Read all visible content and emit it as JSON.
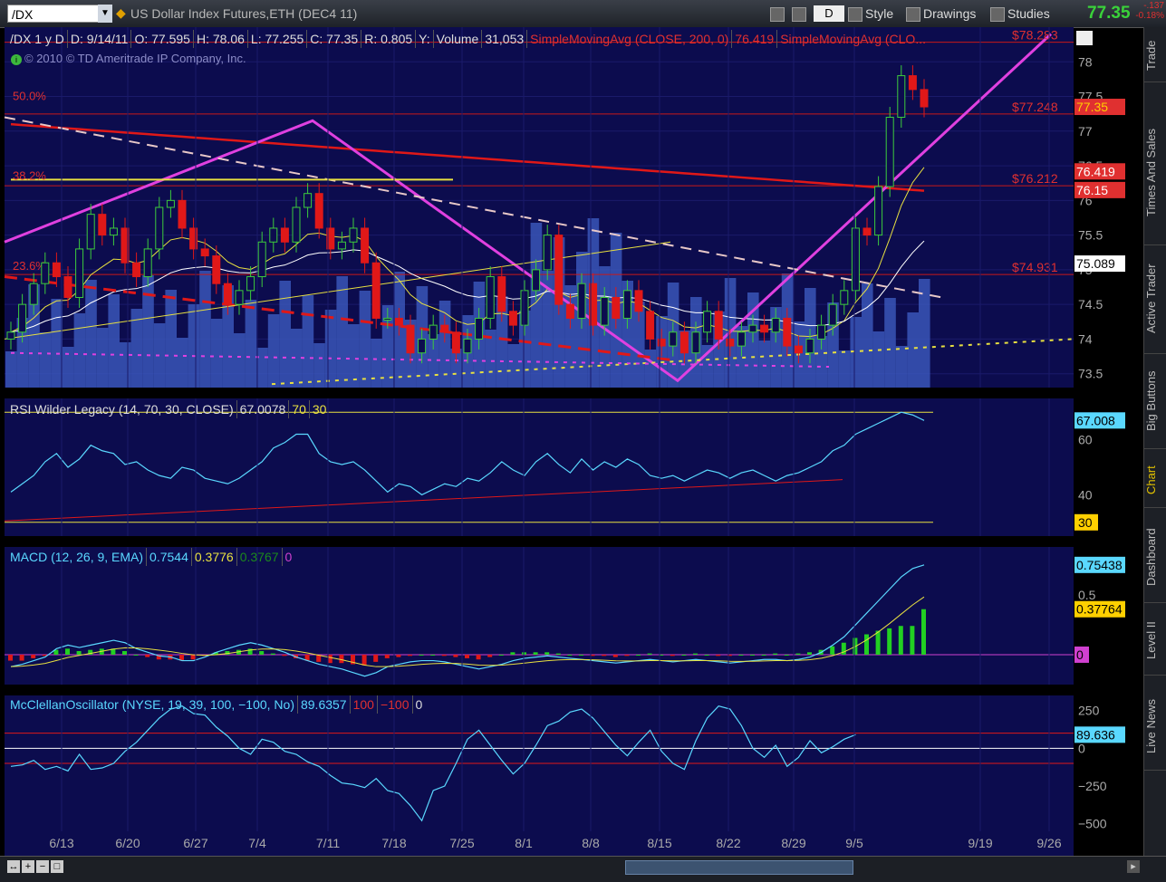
{
  "toolbar": {
    "symbol": "/DX",
    "description": "US Dollar Index Futures,ETH (DEC4 11)",
    "aggregation": "D",
    "style_label": "Style",
    "drawings_label": "Drawings",
    "studies_label": "Studies",
    "last_price": "77.35",
    "net_change": "-.137",
    "pct_change": "-0.18%"
  },
  "side_tabs": [
    "Trade",
    "Times And Sales",
    "Active Trader",
    "Big Buttons",
    "Chart",
    "Dashboard",
    "Level II",
    "Live News"
  ],
  "price_header": {
    "symbol": "/DX 1 y D",
    "date": "D: 9/14/11",
    "open": "O: 77.595",
    "high": "H: 78.06",
    "low": "L: 77.255",
    "close": "C: 77.35",
    "range": "R: 0.805",
    "y": "Y:",
    "volume_label": "Volume",
    "volume": "31,053",
    "sma200": "SimpleMovingAvg (CLOSE, 200, 0)",
    "sma200_val": "76.419",
    "sma2": "SimpleMovingAvg (CLO..."
  },
  "copyright": "© 2010 © TD Ameritrade IP Company, Inc.",
  "fib_labels": {
    "f50": "50.0%",
    "f382": "38.2%",
    "f236": "23.6%",
    "p78": "$78.283",
    "p77": "$77.248",
    "p76": "$76.212",
    "p74": "$74.931"
  },
  "price_badges": {
    "last": "77.35",
    "sma200": "76.419",
    "fib": "76.15",
    "sma": "75.089"
  },
  "rsi": {
    "title": "RSI Wilder Legacy (14, 70, 30, CLOSE)",
    "value": "67.0078",
    "ob": "70",
    "os": "30",
    "badge_val": "67.008",
    "badge_os": "30"
  },
  "macd": {
    "title": "MACD (12, 26, 9, EMA)",
    "v1": "0.7544",
    "v2": "0.3776",
    "v3": "0.3767",
    "v4": "0",
    "badge1": "0.75438",
    "badge2": "0.37764",
    "badge3": "0"
  },
  "mcclellan": {
    "title": "McClellanOscillator (NYSE, 19, 39, 100, −100, No)",
    "value": "89.6357",
    "up": "100",
    "down": "−100",
    "zero": "0",
    "badge": "89.636"
  },
  "colors": {
    "background": "#0c0c4e",
    "up": "#3ccc3c",
    "down": "#e01818",
    "volume": "#3a56b8",
    "fib": "#c81818"
  },
  "chart_data": [
    {
      "type": "candlestick",
      "title": "/DX 1 y D",
      "y_ticks": [
        "73.5",
        "74",
        "74.5",
        "75",
        "75.5",
        "76",
        "76.5",
        "77",
        "77.5",
        "78"
      ],
      "ylim": [
        73.3,
        78.5
      ],
      "x_ticks": [
        "6/13",
        "6/20",
        "6/27",
        "7/4",
        "7/11",
        "7/18",
        "7/25",
        "8/1",
        "8/8",
        "8/15",
        "8/22",
        "8/29",
        "9/5",
        "9/19",
        "9/26"
      ],
      "closes": [
        74.1,
        74.5,
        74.8,
        75.1,
        74.9,
        74.6,
        75.3,
        75.8,
        75.5,
        75.6,
        75.1,
        74.9,
        75.3,
        75.9,
        76.0,
        75.6,
        75.3,
        75.2,
        74.8,
        74.5,
        74.7,
        74.9,
        75.4,
        75.6,
        75.4,
        75.9,
        76.1,
        75.6,
        75.3,
        75.4,
        75.6,
        75.1,
        74.3,
        74.3,
        74.2,
        73.8,
        74.0,
        74.2,
        74.1,
        73.8,
        74.0,
        74.3,
        74.9,
        74.4,
        74.2,
        74.7,
        75.0,
        75.5,
        74.5,
        74.3,
        74.8,
        74.2,
        74.6,
        74.3,
        74.7,
        74.4,
        74.0,
        73.9,
        74.1,
        73.8,
        74.1,
        74.4,
        74.0,
        73.9,
        74.1,
        74.2,
        74.1,
        74.3,
        73.9,
        73.8,
        74.0,
        74.2,
        74.5,
        74.7,
        75.6,
        75.5,
        76.2,
        77.2,
        77.8,
        77.6,
        77.35
      ],
      "volume_fraction_hint": "bars",
      "sma_200_last": 76.419,
      "fib_levels": [
        {
          "pct": "50.0%",
          "price": 77.248
        },
        {
          "pct": "38.2%",
          "price": 76.212
        },
        {
          "pct": "23.6%",
          "price": 74.931
        }
      ]
    },
    {
      "type": "line",
      "title": "RSI Wilder Legacy (14, 70, 30, CLOSE)",
      "y_ticks": [
        "40",
        "60"
      ],
      "ylim": [
        25,
        75
      ],
      "values": [
        41,
        44,
        47,
        52,
        55,
        50,
        53,
        58,
        56,
        55,
        51,
        52,
        49,
        47,
        46,
        50,
        49,
        46,
        45,
        44,
        46,
        49,
        52,
        57,
        59,
        62,
        62,
        55,
        52,
        51,
        52,
        49,
        45,
        41,
        44,
        43,
        40,
        42,
        44,
        43,
        46,
        45,
        48,
        52,
        49,
        47,
        52,
        55,
        51,
        48,
        53,
        49,
        52,
        50,
        53,
        51,
        47,
        46,
        47,
        45,
        47,
        49,
        48,
        46,
        48,
        49,
        47,
        45,
        47,
        48,
        50,
        52,
        56,
        58,
        62,
        64,
        66,
        68,
        70,
        69,
        67
      ]
    },
    {
      "type": "bar",
      "title": "MACD (12, 26, 9, EMA)",
      "y_ticks": [
        "0.5"
      ],
      "ylim": [
        -0.25,
        0.9
      ],
      "macd": [
        -0.1,
        -0.08,
        -0.05,
        -0.02,
        0.05,
        0.08,
        0.06,
        0.08,
        0.1,
        0.12,
        0.1,
        0.05,
        0.02,
        -0.01,
        -0.02,
        -0.05,
        -0.05,
        -0.02,
        0.02,
        0.05,
        0.08,
        0.1,
        0.08,
        0.05,
        0.02,
        -0.02,
        -0.05,
        -0.08,
        -0.1,
        -0.12,
        -0.15,
        -0.18,
        -0.15,
        -0.1,
        -0.08,
        -0.06,
        -0.05,
        -0.05,
        -0.06,
        -0.08,
        -0.1,
        -0.12,
        -0.1,
        -0.08,
        -0.05,
        -0.03,
        -0.02,
        -0.01,
        -0.02,
        -0.03,
        -0.04,
        -0.05,
        -0.06,
        -0.07,
        -0.06,
        -0.05,
        -0.04,
        -0.05,
        -0.06,
        -0.05,
        -0.04,
        -0.05,
        -0.06,
        -0.07,
        -0.06,
        -0.05,
        -0.04,
        -0.04,
        -0.05,
        -0.04,
        -0.02,
        0.02,
        0.08,
        0.15,
        0.25,
        0.35,
        0.45,
        0.55,
        0.65,
        0.72,
        0.75
      ],
      "hist": [
        -0.05,
        -0.05,
        -0.03,
        -0.01,
        0.04,
        0.05,
        0.03,
        0.04,
        0.05,
        0.05,
        0.03,
        0.0,
        -0.02,
        -0.04,
        -0.04,
        -0.05,
        -0.04,
        -0.01,
        0.02,
        0.03,
        0.04,
        0.05,
        0.03,
        0.01,
        -0.01,
        -0.03,
        -0.05,
        -0.06,
        -0.07,
        -0.07,
        -0.08,
        -0.09,
        -0.06,
        -0.03,
        -0.02,
        -0.01,
        0.0,
        0.0,
        -0.01,
        -0.02,
        -0.03,
        -0.04,
        -0.02,
        0.0,
        0.02,
        0.02,
        0.02,
        0.02,
        0.01,
        0.0,
        0.0,
        -0.01,
        -0.01,
        -0.02,
        -0.01,
        0.0,
        0.01,
        0.0,
        -0.01,
        0.0,
        0.01,
        0.0,
        -0.01,
        -0.01,
        0.0,
        0.0,
        0.0,
        0.01,
        0.0,
        0.01,
        0.02,
        0.04,
        0.07,
        0.1,
        0.14,
        0.17,
        0.2,
        0.22,
        0.24,
        0.24,
        0.38
      ]
    },
    {
      "type": "line",
      "title": "McClellanOscillator (NYSE, 19, 39, 100, −100, No)",
      "y_ticks": [
        "250",
        "0",
        "−250",
        "−500"
      ],
      "ylim": [
        -550,
        350
      ],
      "values": [
        -120,
        -110,
        -80,
        -140,
        -120,
        -150,
        -40,
        -140,
        -130,
        -100,
        -20,
        40,
        120,
        200,
        260,
        280,
        230,
        220,
        140,
        80,
        0,
        -40,
        60,
        40,
        -20,
        -40,
        -90,
        -120,
        -180,
        -230,
        -240,
        -260,
        -200,
        -280,
        -300,
        -380,
        -480,
        -280,
        -250,
        -100,
        60,
        120,
        20,
        -80,
        -170,
        -100,
        20,
        150,
        180,
        240,
        260,
        200,
        110,
        20,
        -50,
        40,
        120,
        -20,
        -100,
        -140,
        50,
        200,
        280,
        260,
        150,
        0,
        -60,
        20,
        -120,
        -60,
        50,
        -30,
        10,
        60,
        90
      ],
      "levels": [
        100,
        0,
        -100
      ]
    }
  ]
}
